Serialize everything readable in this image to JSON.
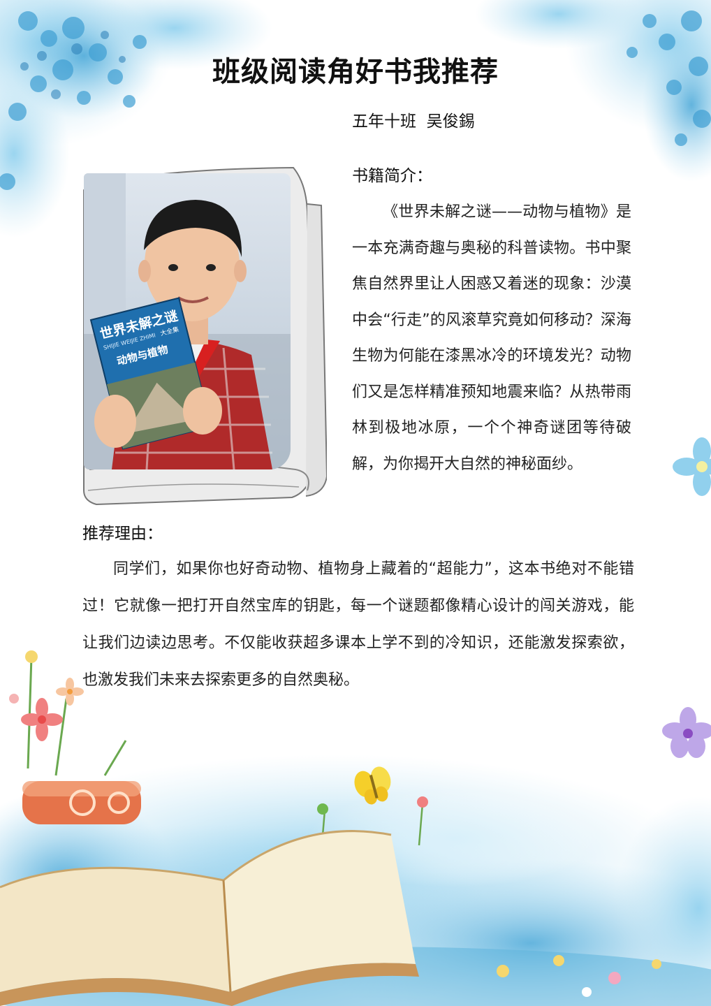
{
  "header": {
    "title": "班级阅读角好书我推荐",
    "author": "五年十班  吴俊錫"
  },
  "intro": {
    "heading": "书籍简介：",
    "body": "《世界未解之谜——动物与植物》是一本充满奇趣与奥秘的科普读物。书中聚焦自然界里让人困惑又着迷的现象：沙漠中会“行走”的风滚草究竟如何移动？深海生物为何能在漆黑冰冷的环境发光？动物们又是怎样精准预知地震来临？从热带雨林到极地冰原，一个个神奇谜团等待破解，为你揭开大自然的神秘面纱。"
  },
  "reason": {
    "heading": "推荐理由：",
    "body": "同学们，如果你也好奇动物、植物身上藏着的“超能力”，这本书绝对不能错过！它就像一把打开自然宝库的钥匙，每一个谜题都像精心设计的闯关游戏，能让我们边读边思考。不仅能收获超多课本上学不到的冷知识，还能激发探索欲，也激发我们未来去探索更多的自然奥秘。"
  },
  "photo": {
    "book_cover_title": "世界未解之谜",
    "book_cover_edition": "大全集",
    "book_cover_subtitle": "动物与植物",
    "book_cover_pinyin": "SHIJIE WEIJIE ZHIMI"
  },
  "colors": {
    "accent_blue": "#5fb4dc",
    "light_blue": "#bfe3f3",
    "scarf_red": "#d82020",
    "book_cover_blue": "#1f6fae"
  }
}
